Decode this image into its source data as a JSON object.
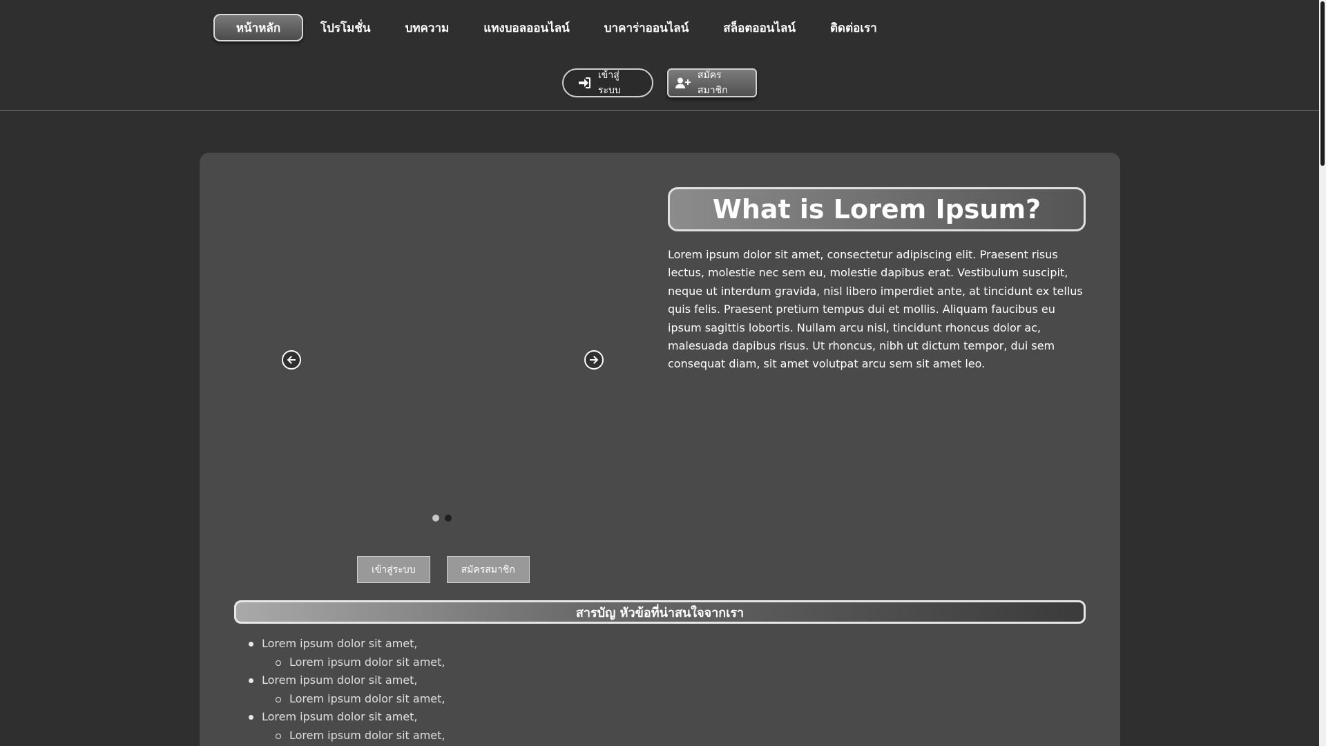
{
  "nav": {
    "items": [
      {
        "label": "หน้าหลัก"
      },
      {
        "label": "โปรโมชั่น"
      },
      {
        "label": "บทความ"
      },
      {
        "label": "แทงบอลออนไลน์"
      },
      {
        "label": "บาคาร่าออนไลน์"
      },
      {
        "label": "สล็อตออนไลน์"
      },
      {
        "label": "ติดต่อเรา"
      }
    ]
  },
  "auth": {
    "login_label": "เข้าสู่ระบบ",
    "register_label": "สมัครสมาชิก"
  },
  "hero": {
    "title": "What is Lorem Ipsum?",
    "description": "Lorem ipsum dolor sit amet, consectetur adipiscing elit. Praesent risus lectus, molestie nec sem eu, molestie dapibus erat. Vestibulum suscipit, neque ut interdum gravida, nisl libero imperdiet ante, at tincidunt ex tellus quis felis. Praesent pretium tempus dui et mollis. Aliquam faucibus eu ipsum sagittis lobortis. Nullam arcu nisl, tincidunt rhoncus dolor ac, malesuada dapibus risus. Ut rhoncus, nibh ut dictum tempor, dui sem consequat diam, sit amet volutpat arcu sem sit amet leo.",
    "login_label": "เข้าสู่ระบบ",
    "register_label": "สมัครสมาชิก"
  },
  "slider": {
    "active_index": 0,
    "slides_count": 2
  },
  "toc": {
    "title": "สารบัญ หัวข้อที่น่าสนใจจากเรา",
    "items": [
      {
        "text": "Lorem ipsum dolor sit amet,",
        "level": 1
      },
      {
        "text": "Lorem ipsum dolor sit amet,",
        "level": 2
      },
      {
        "text": "Lorem ipsum dolor sit amet,",
        "level": 1
      },
      {
        "text": "Lorem ipsum dolor sit amet,",
        "level": 2
      },
      {
        "text": "Lorem ipsum dolor sit amet,",
        "level": 1
      },
      {
        "text": "Lorem ipsum dolor sit amet,",
        "level": 2
      }
    ]
  },
  "colors": {
    "background": "#2f2f2f",
    "card": "#4a4a4a",
    "text": "#ffffff"
  }
}
